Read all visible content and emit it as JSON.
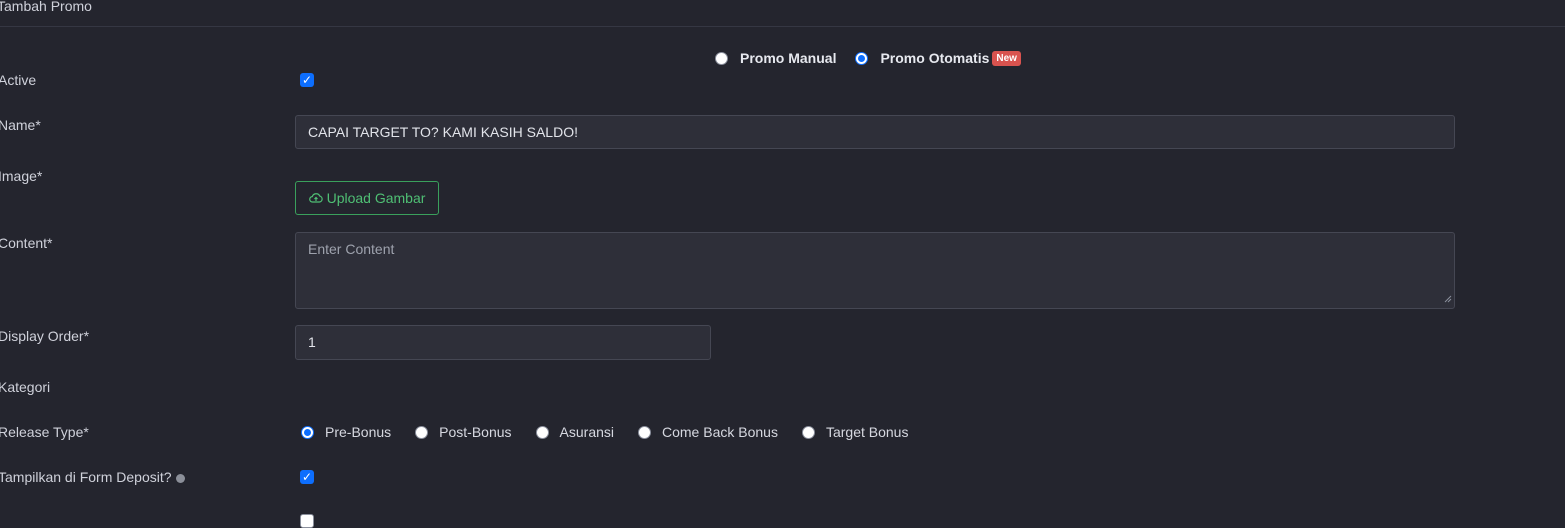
{
  "header": {
    "title": "Tambah Promo"
  },
  "mode": {
    "options": [
      {
        "label": "Promo Manual",
        "selected": false
      },
      {
        "label": "Promo Otomatis",
        "selected": true,
        "badge": "New"
      }
    ]
  },
  "form": {
    "active": {
      "label": "Active",
      "checked": true
    },
    "name": {
      "label": "Name*",
      "value": "CAPAI TARGET TO? KAMI KASIH SALDO!"
    },
    "image": {
      "label": "Image*",
      "button": "Upload Gambar"
    },
    "content": {
      "label": "Content*",
      "placeholder": "Enter Content"
    },
    "display_order": {
      "label": "Display Order*",
      "value": "1"
    },
    "kategori": {
      "label": "Kategori"
    },
    "release_type": {
      "label": "Release Type*",
      "options": [
        "Pre-Bonus",
        "Post-Bonus",
        "Asuransi",
        "Come Back Bonus",
        "Target Bonus"
      ],
      "selected": "Pre-Bonus"
    },
    "deposit_form": {
      "label": "Tampilkan di Form Deposit?",
      "checked": true
    },
    "next_row": {
      "checked": false
    }
  },
  "colors": {
    "accent": "#0d6efd",
    "success": "#3aa05c",
    "badge": "#d9534f",
    "background": "#24252e"
  }
}
